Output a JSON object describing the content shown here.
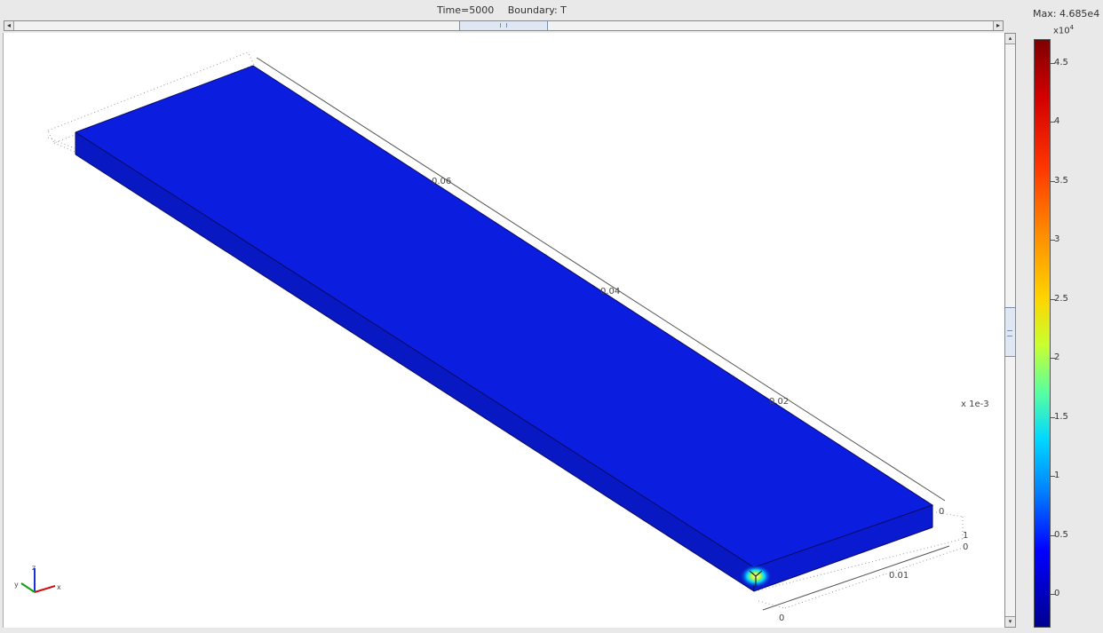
{
  "header": {
    "time_label": "Time=5000",
    "boundary_label": "Boundary: T",
    "max_label": "Max: 4.685e4"
  },
  "axes_labels": {
    "y_ticks": [
      "0.06",
      "0.04",
      "0.02"
    ],
    "x_ticks": [
      "0.01",
      "0"
    ],
    "z_ticks": [
      "0",
      "1"
    ],
    "z_scale": "x 1e-3",
    "second_zero": "0"
  },
  "triad": {
    "x": "x",
    "y": "y",
    "z": "z"
  },
  "colorbar": {
    "exponent_base": "x10",
    "exponent_power": "4",
    "ticks": [
      {
        "label": "4.5",
        "value": 4.5
      },
      {
        "label": "4",
        "value": 4
      },
      {
        "label": "3.5",
        "value": 3.5
      },
      {
        "label": "3",
        "value": 3
      },
      {
        "label": "2.5",
        "value": 2.5
      },
      {
        "label": "2",
        "value": 2
      },
      {
        "label": "1.5",
        "value": 1.5
      },
      {
        "label": "1",
        "value": 1
      },
      {
        "label": "0.5",
        "value": 0.5
      },
      {
        "label": "0",
        "value": 0
      }
    ]
  },
  "colors": {
    "slab_top": "#0b1ee0",
    "slab_side": "#0818c2",
    "hotspot": "#7cff4a"
  },
  "scroll": {
    "left_arrow": "◂",
    "right_arrow": "▸",
    "up_arrow": "▴",
    "down_arrow": "▾"
  }
}
